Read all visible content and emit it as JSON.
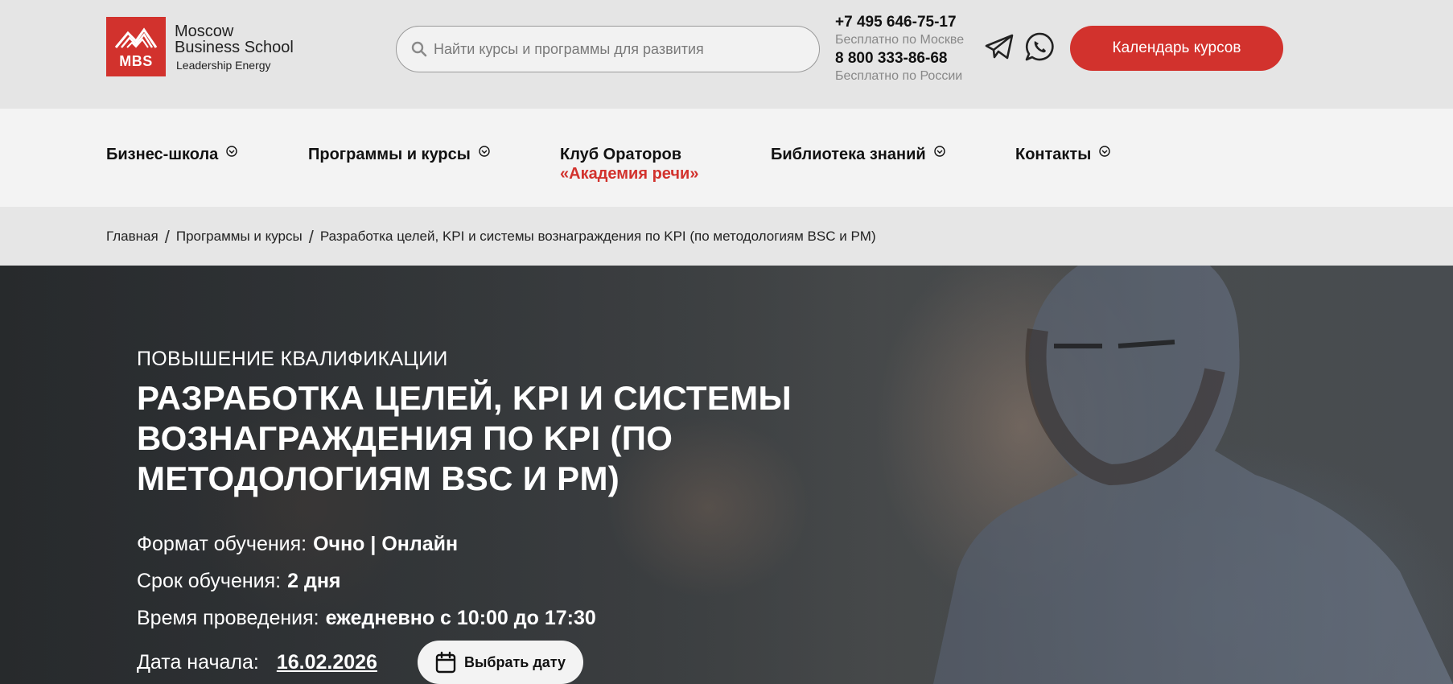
{
  "header": {
    "logo": {
      "line1": "Moscow",
      "line2": "Business School",
      "line3": "Leadership Energy",
      "mark": "MBS"
    },
    "search": {
      "placeholder": "Найти курсы и программы для развития"
    },
    "contacts": {
      "phone_moscow": "+7 495 646-75-17",
      "phone_moscow_note": "Бесплатно по Москве",
      "phone_russia": "8 800 333-86-68",
      "phone_russia_note": "Бесплатно по России"
    },
    "icons": {
      "telegram": "telegram-icon",
      "whatsapp": "whatsapp-icon"
    },
    "calendar_button": "Календарь курсов",
    "brand_color": "#d2322d"
  },
  "nav": {
    "items": [
      {
        "label": "Бизнес-школа",
        "has_dropdown": true
      },
      {
        "label": "Программы и курсы",
        "has_dropdown": true
      },
      {
        "label": "Клуб Ораторов",
        "sublabel": "«Академия речи»",
        "has_dropdown": false
      },
      {
        "label": "Библиотека знаний",
        "has_dropdown": true
      },
      {
        "label": "Контакты",
        "has_dropdown": true
      }
    ]
  },
  "breadcrumb": {
    "items": [
      "Главная",
      "Программы и курсы",
      "Разработка целей, KPI и системы вознаграждения по KPI (по методологиям BSC и PM)"
    ]
  },
  "hero": {
    "kicker": "ПОВЫШЕНИЕ КВАЛИФИКАЦИИ",
    "title": "РАЗРАБОТКА ЦЕЛЕЙ, KPI И СИСТЕМЫ ВОЗНАГРАЖДЕНИЯ ПО KPI (ПО МЕТОДОЛОГИЯМ BSC И PM)",
    "format_label": "Формат обучения:",
    "format_value": "Очно | Онлайн",
    "duration_label": "Срок обучения:",
    "duration_value": "2 дня",
    "time_label": "Время проведения:",
    "time_value": "ежедневно с 10:00 до 17:30",
    "start_label": "Дата начала:",
    "start_value": "16.02.2026",
    "choose_date_button": "Выбрать дату"
  }
}
